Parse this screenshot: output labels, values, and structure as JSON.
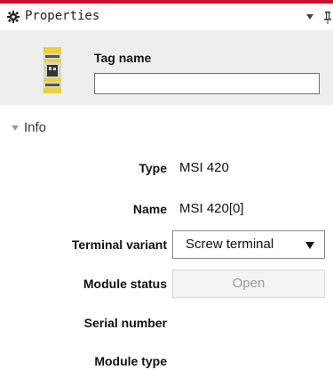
{
  "panel": {
    "title": "Properties",
    "gear_icon": "gear-icon",
    "menu_icon": "dropdown-triangle-icon",
    "pin_icon": "pin-icon",
    "accent_color": "#c8102e"
  },
  "device": {
    "icon": "safety-module-icon",
    "tag_label": "Tag name",
    "tag_value": ""
  },
  "info": {
    "section_label": "Info",
    "type_label": "Type",
    "type_value": "MSI 420",
    "name_label": "Name",
    "name_value": "MSI 420[0]",
    "terminal_label": "Terminal variant",
    "terminal_value": "Screw terminal",
    "status_label": "Module status",
    "status_button": "Open",
    "serial_label": "Serial number",
    "serial_value": "",
    "module_type_label": "Module type",
    "module_type_value": ""
  }
}
